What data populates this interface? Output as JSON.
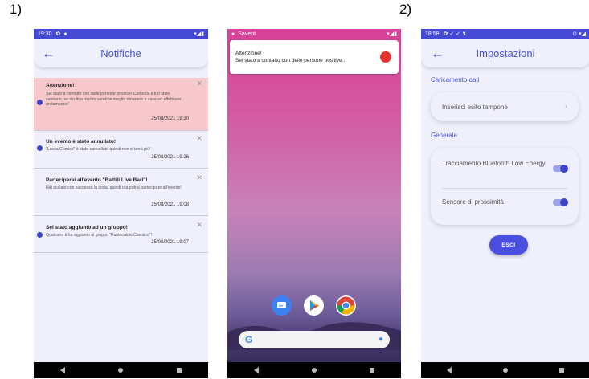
{
  "figure_labels": {
    "one": "1)",
    "two": "2)"
  },
  "phone1": {
    "status_time": "19:30",
    "title": "Notifiche",
    "notifications": [
      {
        "title": "Attenzione!",
        "body": "Sei stato a contatto con delle persone positive!\nControlla il tuo stato sanitario, se risulti a rischio sarebbe meglio rimanere a casa ed effettuare un tampone!",
        "date": "25/08/2021 19:30",
        "unread": true,
        "highlight": true
      },
      {
        "title": "Un evento è stato annullato!",
        "body": "\"Lucca Comics\" è stato cancellato quindi non si terrà più!",
        "date": "25/08/2021 19:26",
        "unread": true,
        "highlight": false
      },
      {
        "title": "Parteciperai all'evento \"Battiti Live Bari\"!",
        "body": "Hai scalato con successo la coda, quindi ora potrai partecipare all'evento!",
        "date": "25/08/2021 19:08",
        "unread": false,
        "highlight": false
      },
      {
        "title": "Sei stato aggiunto ad un gruppo!",
        "body": "Qualcuno ti ha aggiunto al gruppo \"Fantacalcio Classico\"!",
        "date": "25/08/2021 19:07",
        "unread": true,
        "highlight": false
      }
    ],
    "colors": {
      "accent": "#4b50d8",
      "highlight_bg": "#f7c8cc",
      "status_bar": "#4549d6"
    }
  },
  "phone2": {
    "status_app": "Savent",
    "heads_up": {
      "title": "Attenzione!",
      "text": "Sei stato a contatto con delle persone positive.."
    }
  },
  "phone3": {
    "status_time": "18:58",
    "title": "Impostazioni",
    "section_data": "Caricamento dati",
    "item_tampone": "Inserisci esito tampone",
    "section_general": "Generale",
    "toggle_bluetooth": {
      "label": "Tracciamento Bluetooth Low Energy",
      "on": true
    },
    "toggle_proximity": {
      "label": "Sensore di prossimità",
      "on": true
    },
    "exit_button": "ESCI"
  }
}
